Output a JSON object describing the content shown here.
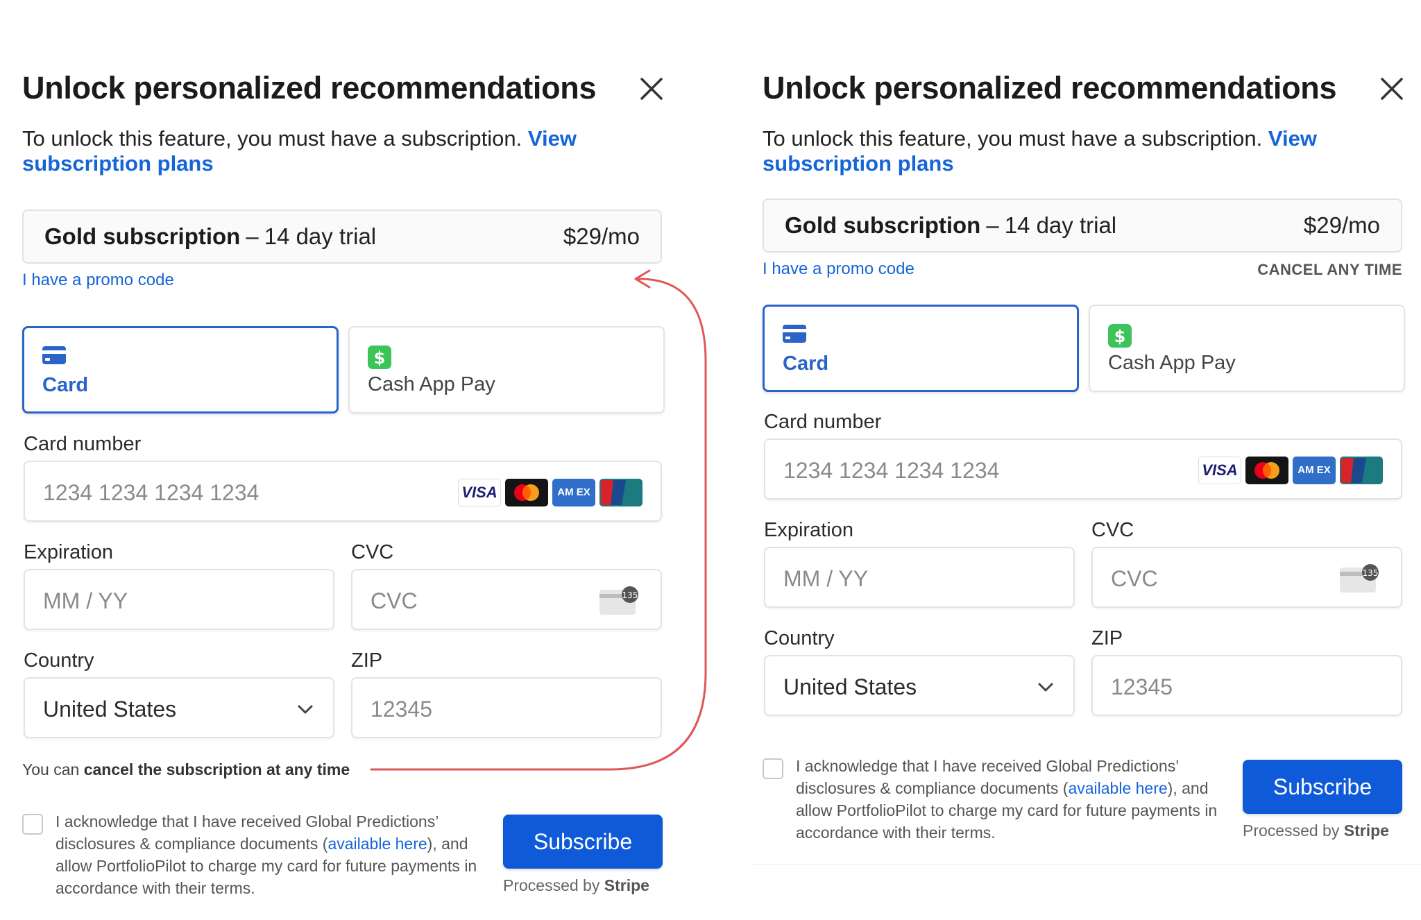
{
  "colors": {
    "accent": "#1565d8",
    "active_tab": "#2a64c9",
    "subscribe_bg": "#0f5ad8",
    "annotation_arrow": "#e05757",
    "cashapp_green": "#3cc35a"
  },
  "panel": {
    "title": "Unlock personalized recommendations",
    "intro_text": "To unlock this feature, you must have a subscription. ",
    "intro_link": "View subscription plans",
    "plan_name": "Gold subscription",
    "plan_sep": "–",
    "plan_trial": "14 day trial",
    "plan_price": "$29/mo",
    "promo_link": "I have a promo code",
    "cancel_any_time": "CANCEL ANY TIME",
    "tabs": {
      "card": "Card",
      "cashapp": "Cash App Pay"
    },
    "card_number_label": "Card number",
    "card_number_placeholder": "1234 1234 1234 1234",
    "card_brands": {
      "visa": "VISA",
      "amex": "AM EX"
    },
    "cvc_badge": "135",
    "expiration_label": "Expiration",
    "expiration_placeholder": "MM / YY",
    "cvc_label": "CVC",
    "cvc_placeholder": "CVC",
    "country_label": "Country",
    "country_value": "United States",
    "zip_label": "ZIP",
    "zip_placeholder": "12345",
    "cancel_note_prefix": "You can ",
    "cancel_note_bold": "cancel the subscription at any time",
    "ack_text": "I acknowledge that I have received Global Predictions’ disclosures & compliance documents (",
    "ack_link": "available here",
    "ack_text_end": "), and allow PortfolioPilot to charge my card for future payments in accordance with their terms.",
    "subscribe_button": "Subscribe",
    "processed_by": "Processed by ",
    "processed_brand": "Stripe"
  },
  "icons": [
    "close-icon",
    "card-icon",
    "cashapp-icon",
    "visa-icon",
    "mastercard-icon",
    "amex-icon",
    "unionpay-icon",
    "cvc-card-icon",
    "chevron-down-icon",
    "checkbox-icon",
    "annotation-arrow"
  ]
}
